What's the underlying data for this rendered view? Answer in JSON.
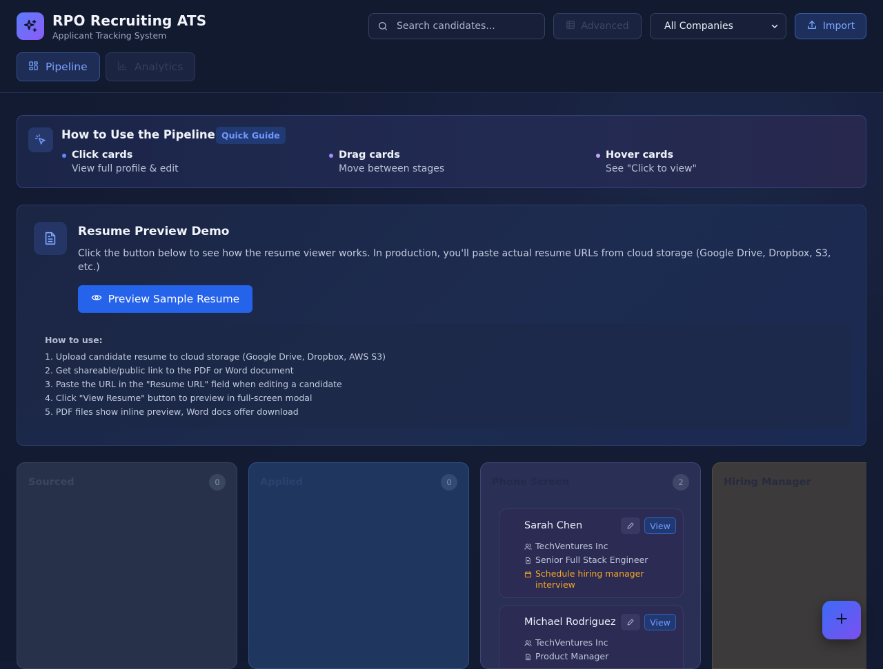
{
  "app": {
    "title": "RPO Recruiting ATS",
    "subtitle": "Applicant Tracking System"
  },
  "header": {
    "search_placeholder": "Search candidates...",
    "advanced_label": "Advanced",
    "company_filter": "All Companies",
    "import_label": "Import"
  },
  "tabs": [
    {
      "label": "Pipeline",
      "active": true
    },
    {
      "label": "Analytics",
      "active": false
    }
  ],
  "guide": {
    "title": "How to Use the Pipeline",
    "badge": "Quick Guide",
    "steps": [
      {
        "title": "Click cards",
        "desc": "View full profile & edit"
      },
      {
        "title": "Drag cards",
        "desc": "Move between stages"
      },
      {
        "title": "Hover cards",
        "desc": "See \"Click to view\""
      }
    ]
  },
  "resume_demo": {
    "title": "Resume Preview Demo",
    "description": "Click the button below to see how the resume viewer works. In production, you'll paste actual resume URLs from cloud storage (Google Drive, Dropbox, S3, etc.)",
    "button_label": "Preview Sample Resume",
    "howto_title": "How to use:",
    "howto_steps": [
      "1. Upload candidate resume to cloud storage (Google Drive, Dropbox, AWS S3)",
      "2. Get shareable/public link to the PDF or Word document",
      "3. Paste the URL in the \"Resume URL\" field when editing a candidate",
      "4. Click \"View Resume\" button to preview in full-screen modal",
      "5. PDF files show inline preview, Word docs offer download"
    ]
  },
  "pipeline": {
    "columns": [
      {
        "title": "Sourced",
        "count": "0"
      },
      {
        "title": "Applied",
        "count": "0"
      },
      {
        "title": "Phone Screen",
        "count": "2"
      },
      {
        "title": "Hiring Manager",
        "count": ""
      }
    ],
    "cards": [
      {
        "name": "Sarah Chen",
        "company": "TechVentures Inc",
        "role": "Senior Full Stack Engineer",
        "action": "Schedule hiring manager interview",
        "view_label": "View"
      },
      {
        "name": "Michael Rodriguez",
        "company": "TechVentures Inc",
        "role": "Product Manager",
        "view_label": "View"
      }
    ]
  },
  "colors": {
    "accent": "#2563eb",
    "accent_text": "#79a2ff",
    "action_text": "#f5a623"
  }
}
